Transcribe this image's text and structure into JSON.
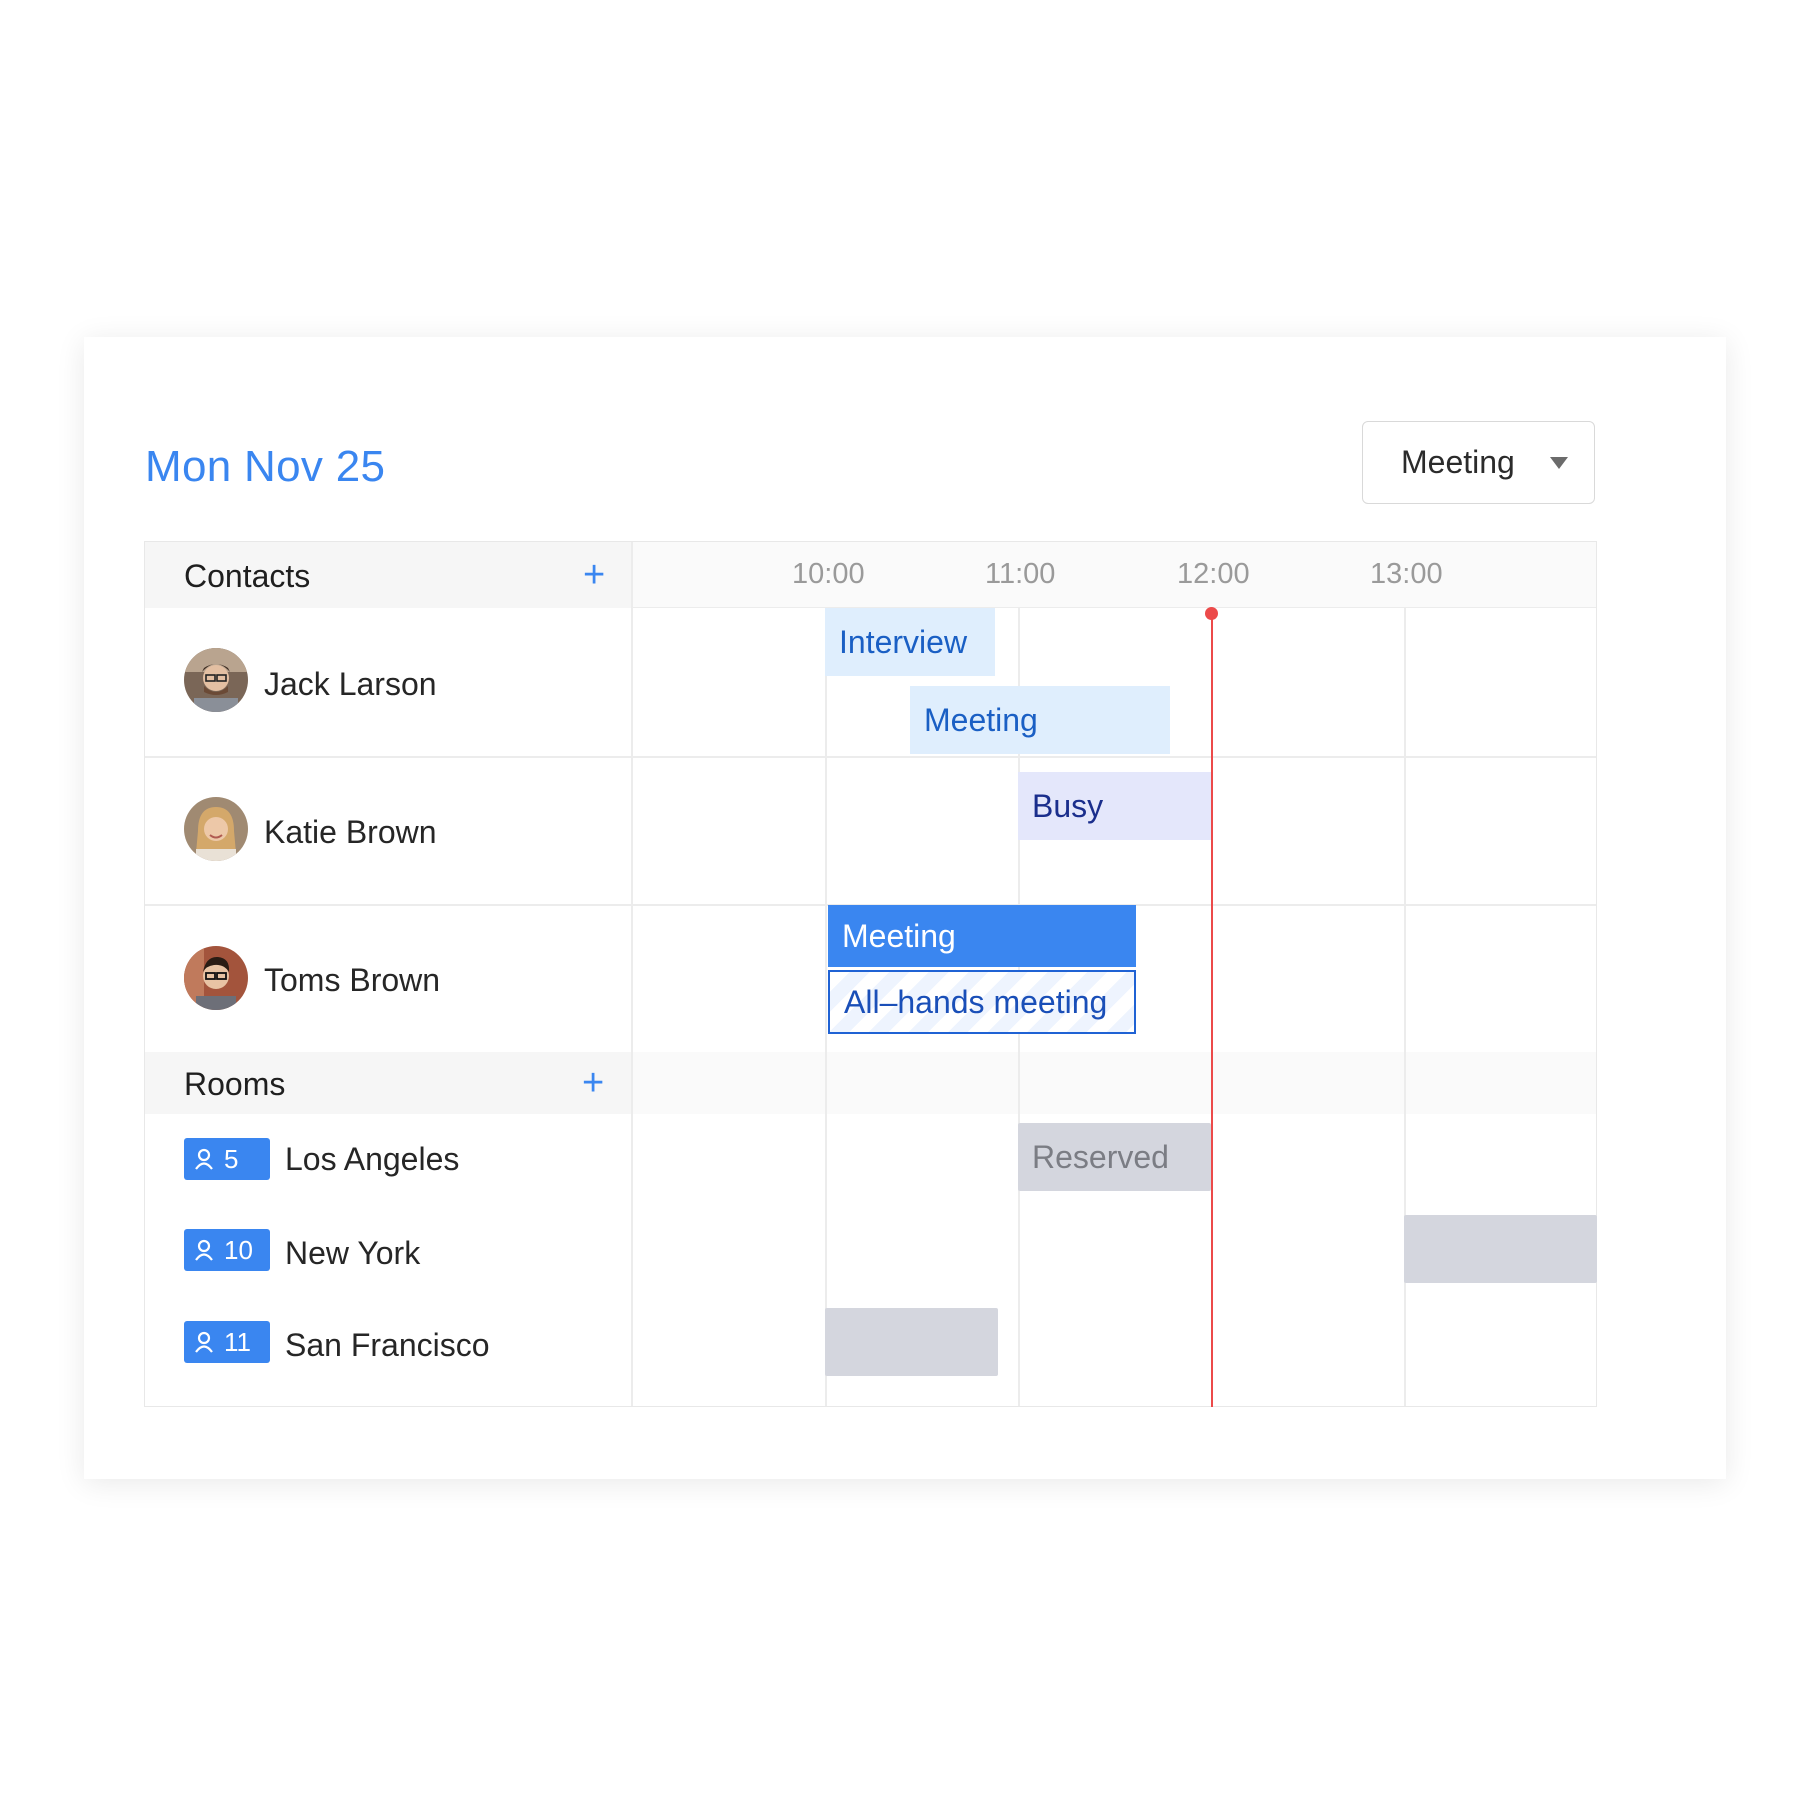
{
  "header": {
    "date_title": "Mon Nov 25",
    "view_select": {
      "selected": "Meeting"
    }
  },
  "contacts_section": {
    "label": "Contacts",
    "add_label": "+"
  },
  "rooms_section": {
    "label": "Rooms",
    "add_label": "+"
  },
  "timeline": {
    "hours": [
      "10:00",
      "11:00",
      "12:00",
      "13:00"
    ],
    "current_time_marker": "12:00"
  },
  "contacts": [
    {
      "name": "Jack Larson"
    },
    {
      "name": "Katie Brown"
    },
    {
      "name": "Toms Brown"
    }
  ],
  "rooms": [
    {
      "capacity": "5",
      "name": "Los Angeles"
    },
    {
      "capacity": "10",
      "name": "New York"
    },
    {
      "capacity": "11",
      "name": "San Francisco"
    }
  ],
  "events": {
    "jack": [
      {
        "label": "Interview",
        "start": "10:00",
        "end": "10:53"
      },
      {
        "label": "Meeting",
        "start": "10:26",
        "end": "11:48"
      }
    ],
    "katie": [
      {
        "label": "Busy",
        "start": "11:00",
        "end": "12:00"
      }
    ],
    "toms": [
      {
        "label": "Meeting",
        "start": "10:00",
        "end": "11:37"
      },
      {
        "label": "All–hands meeting",
        "start": "10:00",
        "end": "11:37"
      }
    ],
    "rooms": [
      {
        "room": "Los Angeles",
        "label": "Reserved",
        "start": "11:00",
        "end": "12:00"
      },
      {
        "room": "New York",
        "label": "",
        "start": "13:00",
        "end": "14:00"
      },
      {
        "room": "San Francisco",
        "label": "",
        "start": "10:00",
        "end": "10:54"
      }
    ]
  },
  "colors": {
    "accent": "#3a86f0",
    "now_line": "#ec4a4a",
    "event_light": "#dfeefd",
    "event_busy": "#e4e7fb",
    "event_reserved": "#d4d6de"
  }
}
